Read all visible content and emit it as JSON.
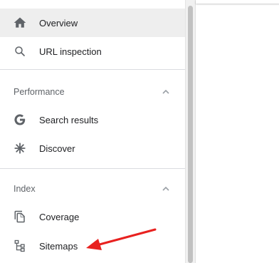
{
  "nav": {
    "overview": {
      "label": "Overview",
      "icon": "home-icon"
    },
    "url_inspection": {
      "label": "URL inspection",
      "icon": "search-icon"
    }
  },
  "sections": {
    "performance": {
      "title": "Performance",
      "items": [
        {
          "label": "Search results",
          "icon": "google-g-icon"
        },
        {
          "label": "Discover",
          "icon": "asterisk-icon"
        }
      ]
    },
    "index": {
      "title": "Index",
      "items": [
        {
          "label": "Coverage",
          "icon": "copy-pages-icon"
        },
        {
          "label": "Sitemaps",
          "icon": "sitemap-tree-icon"
        }
      ]
    }
  },
  "colors": {
    "active_bg": "#eeeeee",
    "text": "#202124",
    "muted": "#5f6368",
    "annotation_arrow": "#e8211f"
  }
}
